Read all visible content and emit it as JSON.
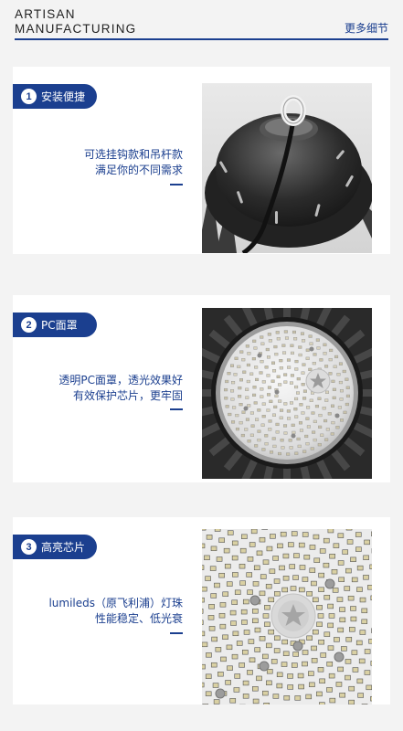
{
  "header": {
    "brand_line1": "ARTISAN",
    "brand_line2": "MANUFACTURING",
    "more_details": "更多细节"
  },
  "features": [
    {
      "number": "1",
      "title": "安装便捷",
      "desc_line1": "可选挂钩款和吊杆款",
      "desc_line2": "满足你的不同需求",
      "dash": "—"
    },
    {
      "number": "2",
      "title": "PC面罩",
      "desc_line1": "透明PC面罩，透光效果好",
      "desc_line2": "有效保护芯片，更牢固",
      "dash": "—"
    },
    {
      "number": "3",
      "title": "高亮芯片",
      "desc_line1": "lumileds（原飞利浦）灯珠",
      "desc_line2": "性能稳定、低光衰",
      "dash": "—"
    }
  ],
  "colors": {
    "brand_blue": "#1b3f8f",
    "page_bg": "#f3f3f3",
    "card_bg": "#ffffff"
  }
}
